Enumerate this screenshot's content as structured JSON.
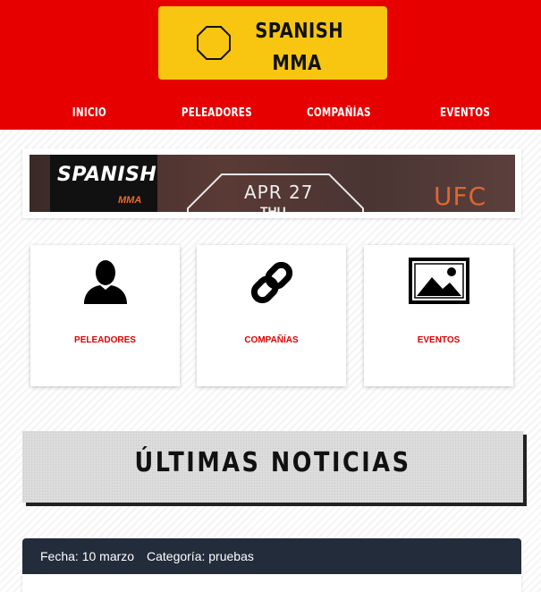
{
  "logo": {
    "line1": "SPANISH",
    "line2": "MMA",
    "icon": "octagon-icon"
  },
  "nav": {
    "items": [
      {
        "label": "INICIO"
      },
      {
        "label": "PELEADORES"
      },
      {
        "label": "COMPAÑÍAS"
      },
      {
        "label": "EVENTOS"
      }
    ]
  },
  "banner": {
    "brand": "SPANISH",
    "brand_sub": "MMA",
    "date": "APR 27",
    "day": "THU",
    "org": "UFC"
  },
  "cards": [
    {
      "label": "PELEADORES",
      "icon": "person-icon"
    },
    {
      "label": "COMPAÑÍAS",
      "icon": "link-icon"
    },
    {
      "label": "EVENTOS",
      "icon": "image-icon"
    }
  ],
  "section": {
    "title": "ÚLTIMAS NOTICIAS"
  },
  "post": {
    "date": "Fecha: 10 marzo",
    "category": "Categoría: pruebas"
  },
  "colors": {
    "header": "#e60000",
    "logo_bg": "#f8c511",
    "accent": "#dd0000",
    "post_header": "#232c3b"
  }
}
